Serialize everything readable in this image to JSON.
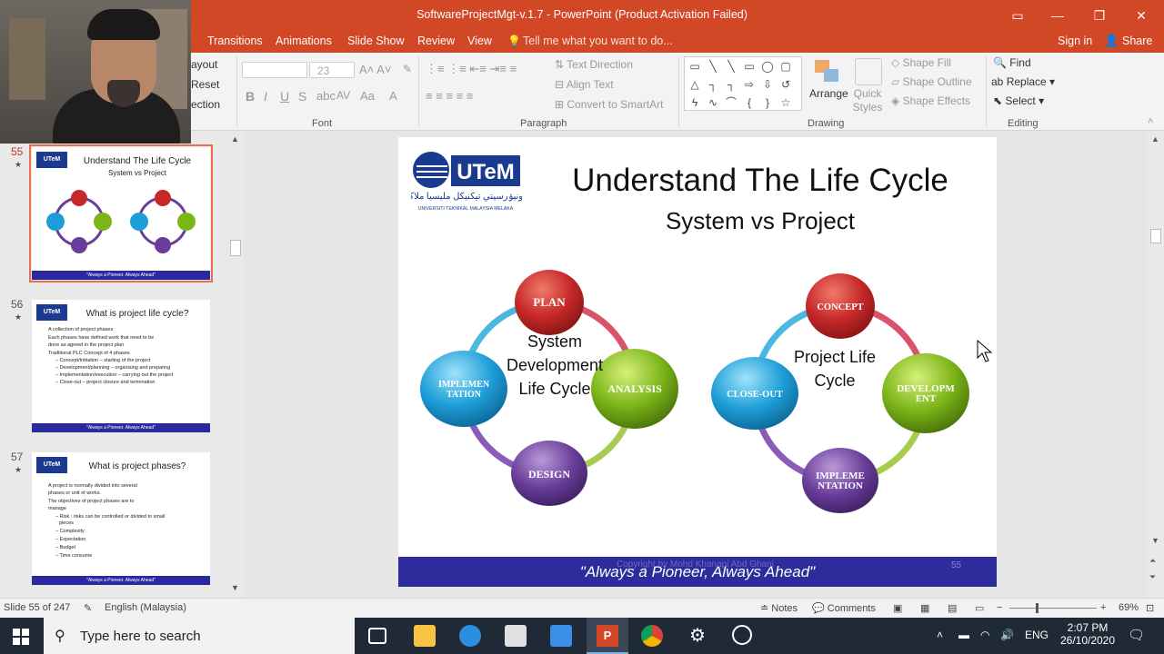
{
  "window": {
    "title": "SoftwareProjectMgt-v.1.7 - PowerPoint (Product Activation Failed)"
  },
  "tabs": [
    "Transitions",
    "Animations",
    "Slide Show",
    "Review",
    "View"
  ],
  "tell_me": "Tell me what you want to do...",
  "sign_in": "Sign in",
  "share": "Share",
  "ribbon": {
    "slides_group": {
      "layout": "ayout",
      "reset": "Reset",
      "section": "ection"
    },
    "font_size": "23",
    "font_label": "Font",
    "paragraph_label": "Paragraph",
    "drawing_label": "Drawing",
    "editing_label": "Editing",
    "text_direction": "Text Direction",
    "align_text": "Align Text",
    "convert_smartart": "Convert to SmartArt",
    "arrange": "Arrange",
    "quick_styles": "Quick Styles",
    "shape_fill": "Shape Fill",
    "shape_outline": "Shape Outline",
    "shape_effects": "Shape Effects",
    "find": "Find",
    "replace": "Replace",
    "select": "Select"
  },
  "thumbnails": [
    {
      "num": "55",
      "title": "Understand The Life Cycle",
      "subtitle": "System vs Project",
      "footer": "\"Always a Pioneer, Always Ahead\""
    },
    {
      "num": "56",
      "title": "What is project life cycle?",
      "bullets": [
        "A collection of project phases",
        "Each phases have defined work that need to be",
        "done as agreed in the project plan",
        "Traditional PLC Concept of 4 phases",
        "– Concept/Initiation – starting of the project",
        "– Development/planning – organising and preparing",
        "– Implementation/execution – carrying out the project",
        "– Close-out – project closure and termination"
      ],
      "footer": "\"Always a Pioneer, Always Ahead\""
    },
    {
      "num": "57",
      "title": "What is project phases?",
      "bullets": [
        "A project is normally divided into several",
        "phases or unit of works.",
        "The objectives of project phases are to",
        "manage",
        "– Risk : risks can be controlled or divided to small",
        "pieces",
        "– Complexity",
        "– Expectation",
        "– Budget",
        "– Time consume"
      ],
      "footer": "\"Always a Pioneer, Always Ahead\""
    }
  ],
  "slide": {
    "logo_text": "UTeM",
    "logo_sub": "UNIVERSITI TEKNIKAL MALAYSIA MELAKA",
    "title": "Understand The Life Cycle",
    "subtitle": "System vs Project",
    "left_cycle": {
      "label_lines": [
        "System",
        "Development",
        "Life Cycle"
      ],
      "nodes": [
        "PLAN",
        "ANALYSIS",
        "DESIGN",
        "IMPLEMEN TATION"
      ]
    },
    "right_cycle": {
      "label_lines": [
        "Project Life",
        "Cycle"
      ],
      "nodes": [
        "CONCEPT",
        "DEVELOPM ENT",
        "IMPLEME NTATION",
        "CLOSE-OUT"
      ]
    },
    "footer": "\"Always a Pioneer, Always Ahead\"",
    "copyright": "Copyright by Mohd Khanapi Abd Ghani",
    "page_number": "55"
  },
  "status": {
    "slide_of": "Slide 55 of 247",
    "language": "English (Malaysia)",
    "notes": "Notes",
    "comments": "Comments",
    "zoom": "69%"
  },
  "taskbar": {
    "search_placeholder": "Type here to search",
    "lang": "ENG",
    "time": "2:07 PM",
    "date": "26/10/2020"
  },
  "colors": {
    "accent": "#d24726",
    "footer_blue": "#2c2c9c",
    "node_red": "#c62828",
    "node_green": "#7cb518",
    "node_purple": "#6a3d9a",
    "node_blue": "#1e9ed8"
  }
}
